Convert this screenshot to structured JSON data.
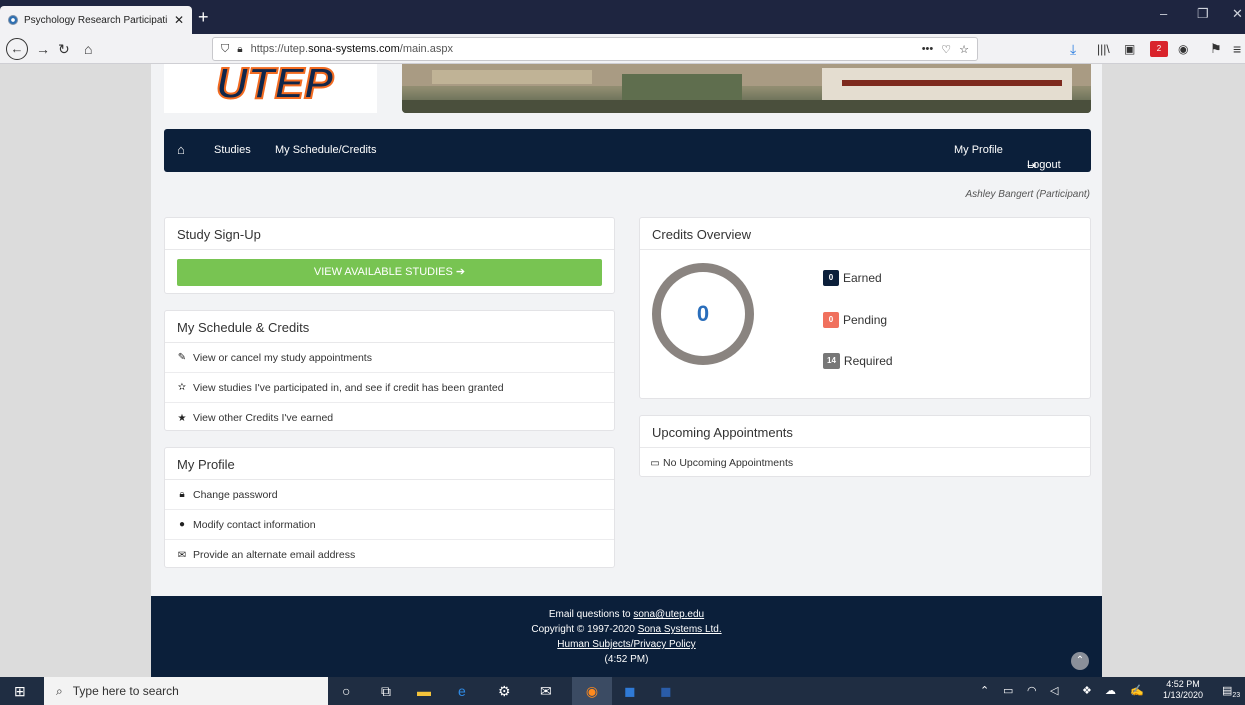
{
  "browser": {
    "tab_title": "Psychology Research Participati",
    "url_host": "https://utep.",
    "url_domain": "sona-systems.com",
    "url_path": "/main.aspx",
    "ext_badge": "2"
  },
  "nav": {
    "items": [
      "Studies",
      "My Schedule/Credits"
    ],
    "profile": "My Profile",
    "logout": "Logout"
  },
  "user": "Ashley Bangert (Participant)",
  "signup": {
    "title": "Study Sign-Up",
    "button": "VIEW AVAILABLE STUDIES"
  },
  "schedule": {
    "title": "My Schedule & Credits",
    "items": [
      {
        "icon": "edit-icon",
        "label": "View or cancel my study appointments"
      },
      {
        "icon": "half-star-icon",
        "label": "View studies I've participated in, and see if credit has been granted"
      },
      {
        "icon": "star-icon",
        "label": "View other Credits I've earned"
      }
    ]
  },
  "profile": {
    "title": "My Profile",
    "items": [
      {
        "icon": "lock-icon",
        "label": "Change password"
      },
      {
        "icon": "user-icon",
        "label": "Modify contact information"
      },
      {
        "icon": "envelope-icon",
        "label": "Provide an alternate email address"
      }
    ]
  },
  "credits": {
    "title": "Credits Overview",
    "total": "0",
    "earned_count": "0",
    "earned_label": "Earned",
    "earned_color": "#0b1f3a",
    "pending_count": "0",
    "pending_label": "Pending",
    "pending_color": "#f0705d",
    "required_count": "14",
    "required_label": "Required",
    "required_color": "#777777"
  },
  "appointments": {
    "title": "Upcoming Appointments",
    "empty": "No Upcoming Appointments"
  },
  "footer": {
    "email_prefix": "Email questions to ",
    "email": "sona@utep.edu",
    "copyright_prefix": "Copyright © 1997-2020 ",
    "company": "Sona Systems Ltd.",
    "policy": "Human Subjects/Privacy Policy",
    "time": "(4:52 PM)"
  },
  "taskbar": {
    "search_placeholder": "Type here to search",
    "time": "4:52 PM",
    "date": "1/13/2020",
    "notif_count": "23"
  }
}
